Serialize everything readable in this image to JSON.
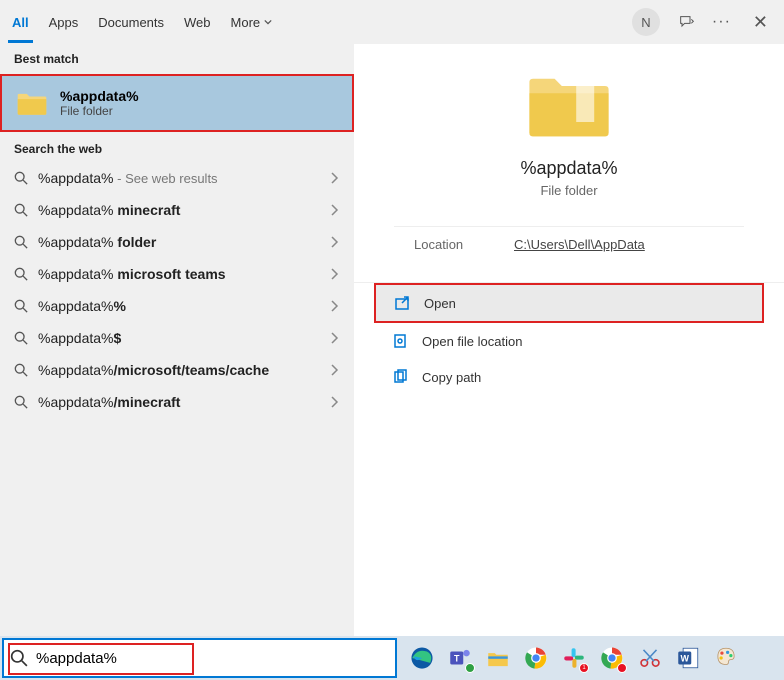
{
  "header": {
    "tabs": [
      "All",
      "Apps",
      "Documents",
      "Web",
      "More"
    ],
    "active_tab": 0,
    "avatar_initial": "N"
  },
  "left": {
    "best_match_label": "Best match",
    "best_match": {
      "title": "%appdata%",
      "subtitle": "File folder"
    },
    "search_web_label": "Search the web",
    "suggestions": [
      {
        "prefix": "%appdata%",
        "suffix": "",
        "hint": " - See web results"
      },
      {
        "prefix": "%appdata%",
        "suffix": " minecraft",
        "hint": ""
      },
      {
        "prefix": "%appdata%",
        "suffix": " folder",
        "hint": ""
      },
      {
        "prefix": "%appdata%",
        "suffix": " microsoft teams",
        "hint": ""
      },
      {
        "prefix": "%appdata%",
        "suffix": "%",
        "hint": ""
      },
      {
        "prefix": "%appdata%",
        "suffix": "$",
        "hint": ""
      },
      {
        "prefix": "%appdata%",
        "suffix": "/microsoft/teams/cache",
        "hint": ""
      },
      {
        "prefix": "%appdata%",
        "suffix": "/minecraft",
        "hint": ""
      }
    ]
  },
  "right": {
    "title": "%appdata%",
    "subtitle": "File folder",
    "location_label": "Location",
    "location_value": "C:\\Users\\Dell\\AppData",
    "actions": [
      {
        "label": "Open",
        "icon": "open",
        "highlighted": true
      },
      {
        "label": "Open file location",
        "icon": "file-location",
        "highlighted": false
      },
      {
        "label": "Copy path",
        "icon": "copy",
        "highlighted": false
      }
    ]
  },
  "taskbar": {
    "search_value": "%appdata%"
  }
}
